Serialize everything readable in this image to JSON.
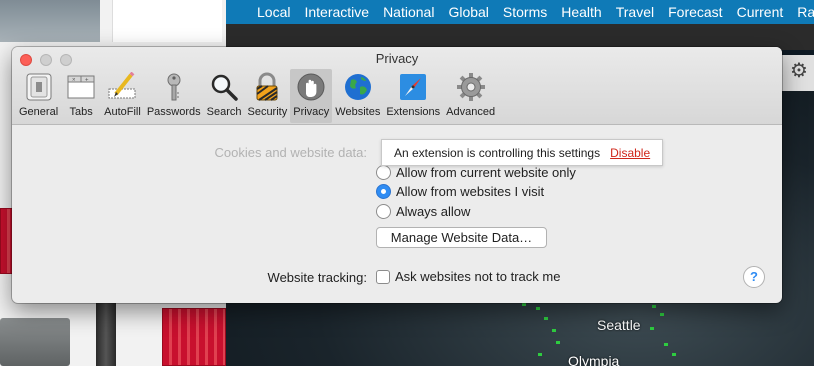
{
  "background": {
    "nav": [
      "Local",
      "Interactive",
      "National",
      "Global",
      "Storms",
      "Health",
      "Travel",
      "Forecast",
      "Current",
      "Rad"
    ],
    "map_labels": {
      "city1": "Seattle",
      "city2": "Olympia"
    },
    "nav_color": "#0f7ab7"
  },
  "window": {
    "title": "Privacy"
  },
  "toolbar": {
    "items": [
      {
        "label": "General",
        "icon": "general-switch-icon"
      },
      {
        "label": "Tabs",
        "icon": "tabs-window-icon"
      },
      {
        "label": "AutoFill",
        "icon": "pencil-form-icon"
      },
      {
        "label": "Passwords",
        "icon": "key-icon"
      },
      {
        "label": "Search",
        "icon": "magnifier-icon"
      },
      {
        "label": "Security",
        "icon": "padlock-icon"
      },
      {
        "label": "Privacy",
        "icon": "hand-icon"
      },
      {
        "label": "Websites",
        "icon": "globe-icon"
      },
      {
        "label": "Extensions",
        "icon": "compass-icon"
      },
      {
        "label": "Advanced",
        "icon": "gear-icon"
      }
    ],
    "selected": "Privacy"
  },
  "privacy": {
    "cookies_label": "Cookies and website data:",
    "cookie_options": [
      {
        "label": "Allow from current website only",
        "selected": false
      },
      {
        "label": "Allow from websites I visit",
        "selected": true
      },
      {
        "label": "Always allow",
        "selected": false
      }
    ],
    "manage_button": "Manage Website Data…",
    "tracking_label": "Website tracking:",
    "tracking_checkbox": "Ask websites not to track me",
    "tracking_checked": false,
    "help": "?"
  },
  "extension_notice": {
    "message": "An extension is controlling this settings",
    "action": "Disable"
  }
}
